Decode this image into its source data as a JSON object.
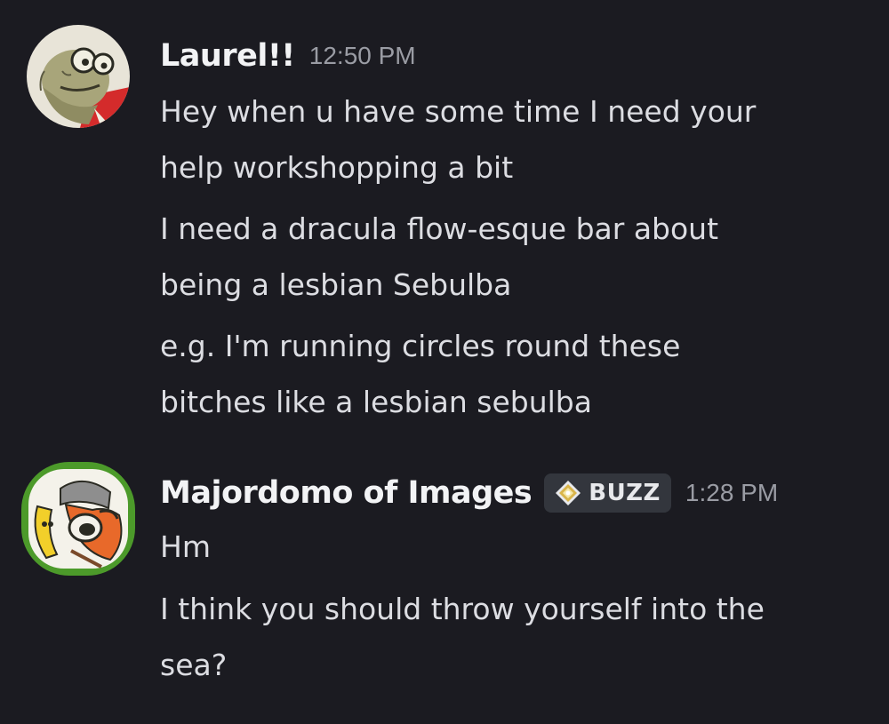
{
  "messages": [
    {
      "username": "Laurel!!",
      "time": "12:50 PM",
      "avatar_icon": "sebulba-avatar",
      "lines": [
        [
          "Hey when u have some time I need your",
          "help workshopping a bit"
        ],
        [
          "I need a dracula flow-esque bar about",
          "being a lesbian Sebulba"
        ],
        [
          "e.g. I'm running circles round these",
          "bitches like a lesbian sebulba"
        ]
      ]
    },
    {
      "username": "Majordomo of Images",
      "tag": {
        "icon": "diamond-sparkle-icon",
        "label": "BUZZ"
      },
      "time": "1:28 PM",
      "avatar_icon": "cartoon-character-avatar",
      "lines": [
        [
          "Hm"
        ],
        [
          "I think you should throw yourself into the",
          "sea?"
        ]
      ]
    }
  ],
  "colors": {
    "background": "#1b1b21",
    "username": "#f2f3f5",
    "text": "#dcdde2",
    "timestamp": "#9a9ca4",
    "tag_bg": "#33363d"
  }
}
